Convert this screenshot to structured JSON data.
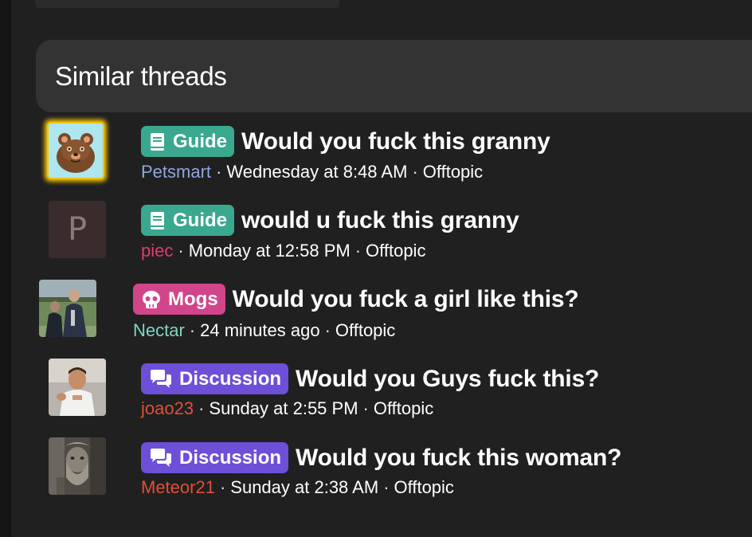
{
  "section": {
    "title": "Similar threads"
  },
  "colors": {
    "guide": "#3aa88e",
    "mogs": "#d2458a",
    "discussion": "#6d4fd8",
    "username_petsmart": "#8fa6e0",
    "username_piec": "#e03c6e",
    "username_nectar": "#7fd6c2",
    "username_joao23": "#e0503a",
    "username_meteor21": "#e0503a"
  },
  "threads": [
    {
      "avatar": "cartoon-bear",
      "prefix": "Guide",
      "prefix_icon": "book-icon",
      "title": "Would you fuck this granny",
      "username": "Petsmart",
      "time": "Wednesday at 8:48 AM",
      "forum": "Offtopic"
    },
    {
      "avatar": "letter-p",
      "avatar_letter": "P",
      "prefix": "Guide",
      "prefix_icon": "book-icon",
      "title": "would u fuck this granny",
      "username": "piec",
      "time": "Monday at 12:58 PM",
      "forum": "Offtopic"
    },
    {
      "avatar": "photo-people",
      "prefix": "Mogs",
      "prefix_icon": "skull-icon",
      "title": "Would you fuck a girl like this?",
      "username": "Nectar",
      "time": "24 minutes ago",
      "forum": "Offtopic"
    },
    {
      "avatar": "photo-man",
      "prefix": "Discussion",
      "prefix_icon": "chat-bubbles-icon",
      "title": "Would you Guys fuck this?",
      "username": "joao23",
      "time": "Sunday at 2:55 PM",
      "forum": "Offtopic"
    },
    {
      "avatar": "photo-statue",
      "prefix": "Discussion",
      "prefix_icon": "chat-bubbles-icon",
      "title": "Would you fuck this woman?",
      "username": "Meteor21",
      "time": "Sunday at 2:38 AM",
      "forum": "Offtopic"
    }
  ]
}
